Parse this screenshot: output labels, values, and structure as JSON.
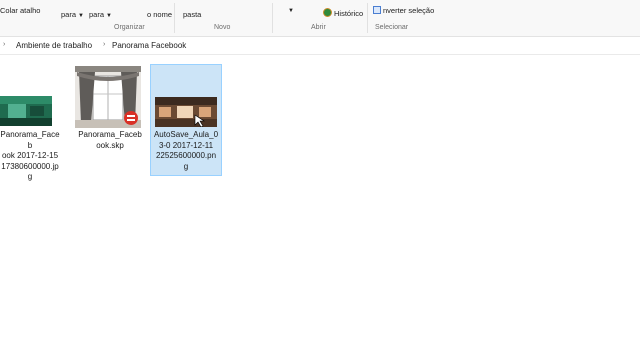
{
  "ribbon": {
    "colar_atalho": "Colar atalho",
    "mover_para": "para",
    "copiar_para": "para",
    "renomear": "o nome",
    "nova_pasta": "pasta",
    "historico": "Histórico",
    "inverter_selecao": "nverter seleção",
    "groups": {
      "organizar": "Organizar",
      "novo": "Novo",
      "abrir": "Abrir",
      "selecionar": "Selecionar"
    }
  },
  "breadcrumb": {
    "items": [
      "Ambiente de trabalho",
      "Panorama Facebook"
    ]
  },
  "files": [
    {
      "name": "Panorama_Facebook 2017-12-15 17380600000.jpg",
      "lines": [
        "Panorama_Faceb",
        "ook 2017-12-15",
        "17380600000.jpg"
      ],
      "selected": false
    },
    {
      "name": "Panorama_Facebook.skp",
      "lines": [
        "Panorama_Faceb",
        "ook.skp"
      ],
      "selected": false
    },
    {
      "name": "AutoSave_Aula_03-0 2017-12-11 22525600000.png",
      "lines": [
        "AutoSave_Aula_0",
        "3-0 2017-12-11",
        "22525600000.pn",
        "g"
      ],
      "selected": true
    }
  ],
  "icons": {
    "caret": "chevron-down-icon",
    "breadcrumb_separator": "chevron-right-icon"
  },
  "colors": {
    "selection_bg": "#cce4f7",
    "selection_border": "#99d1ff",
    "ribbon_bg": "#f8f8f8"
  }
}
